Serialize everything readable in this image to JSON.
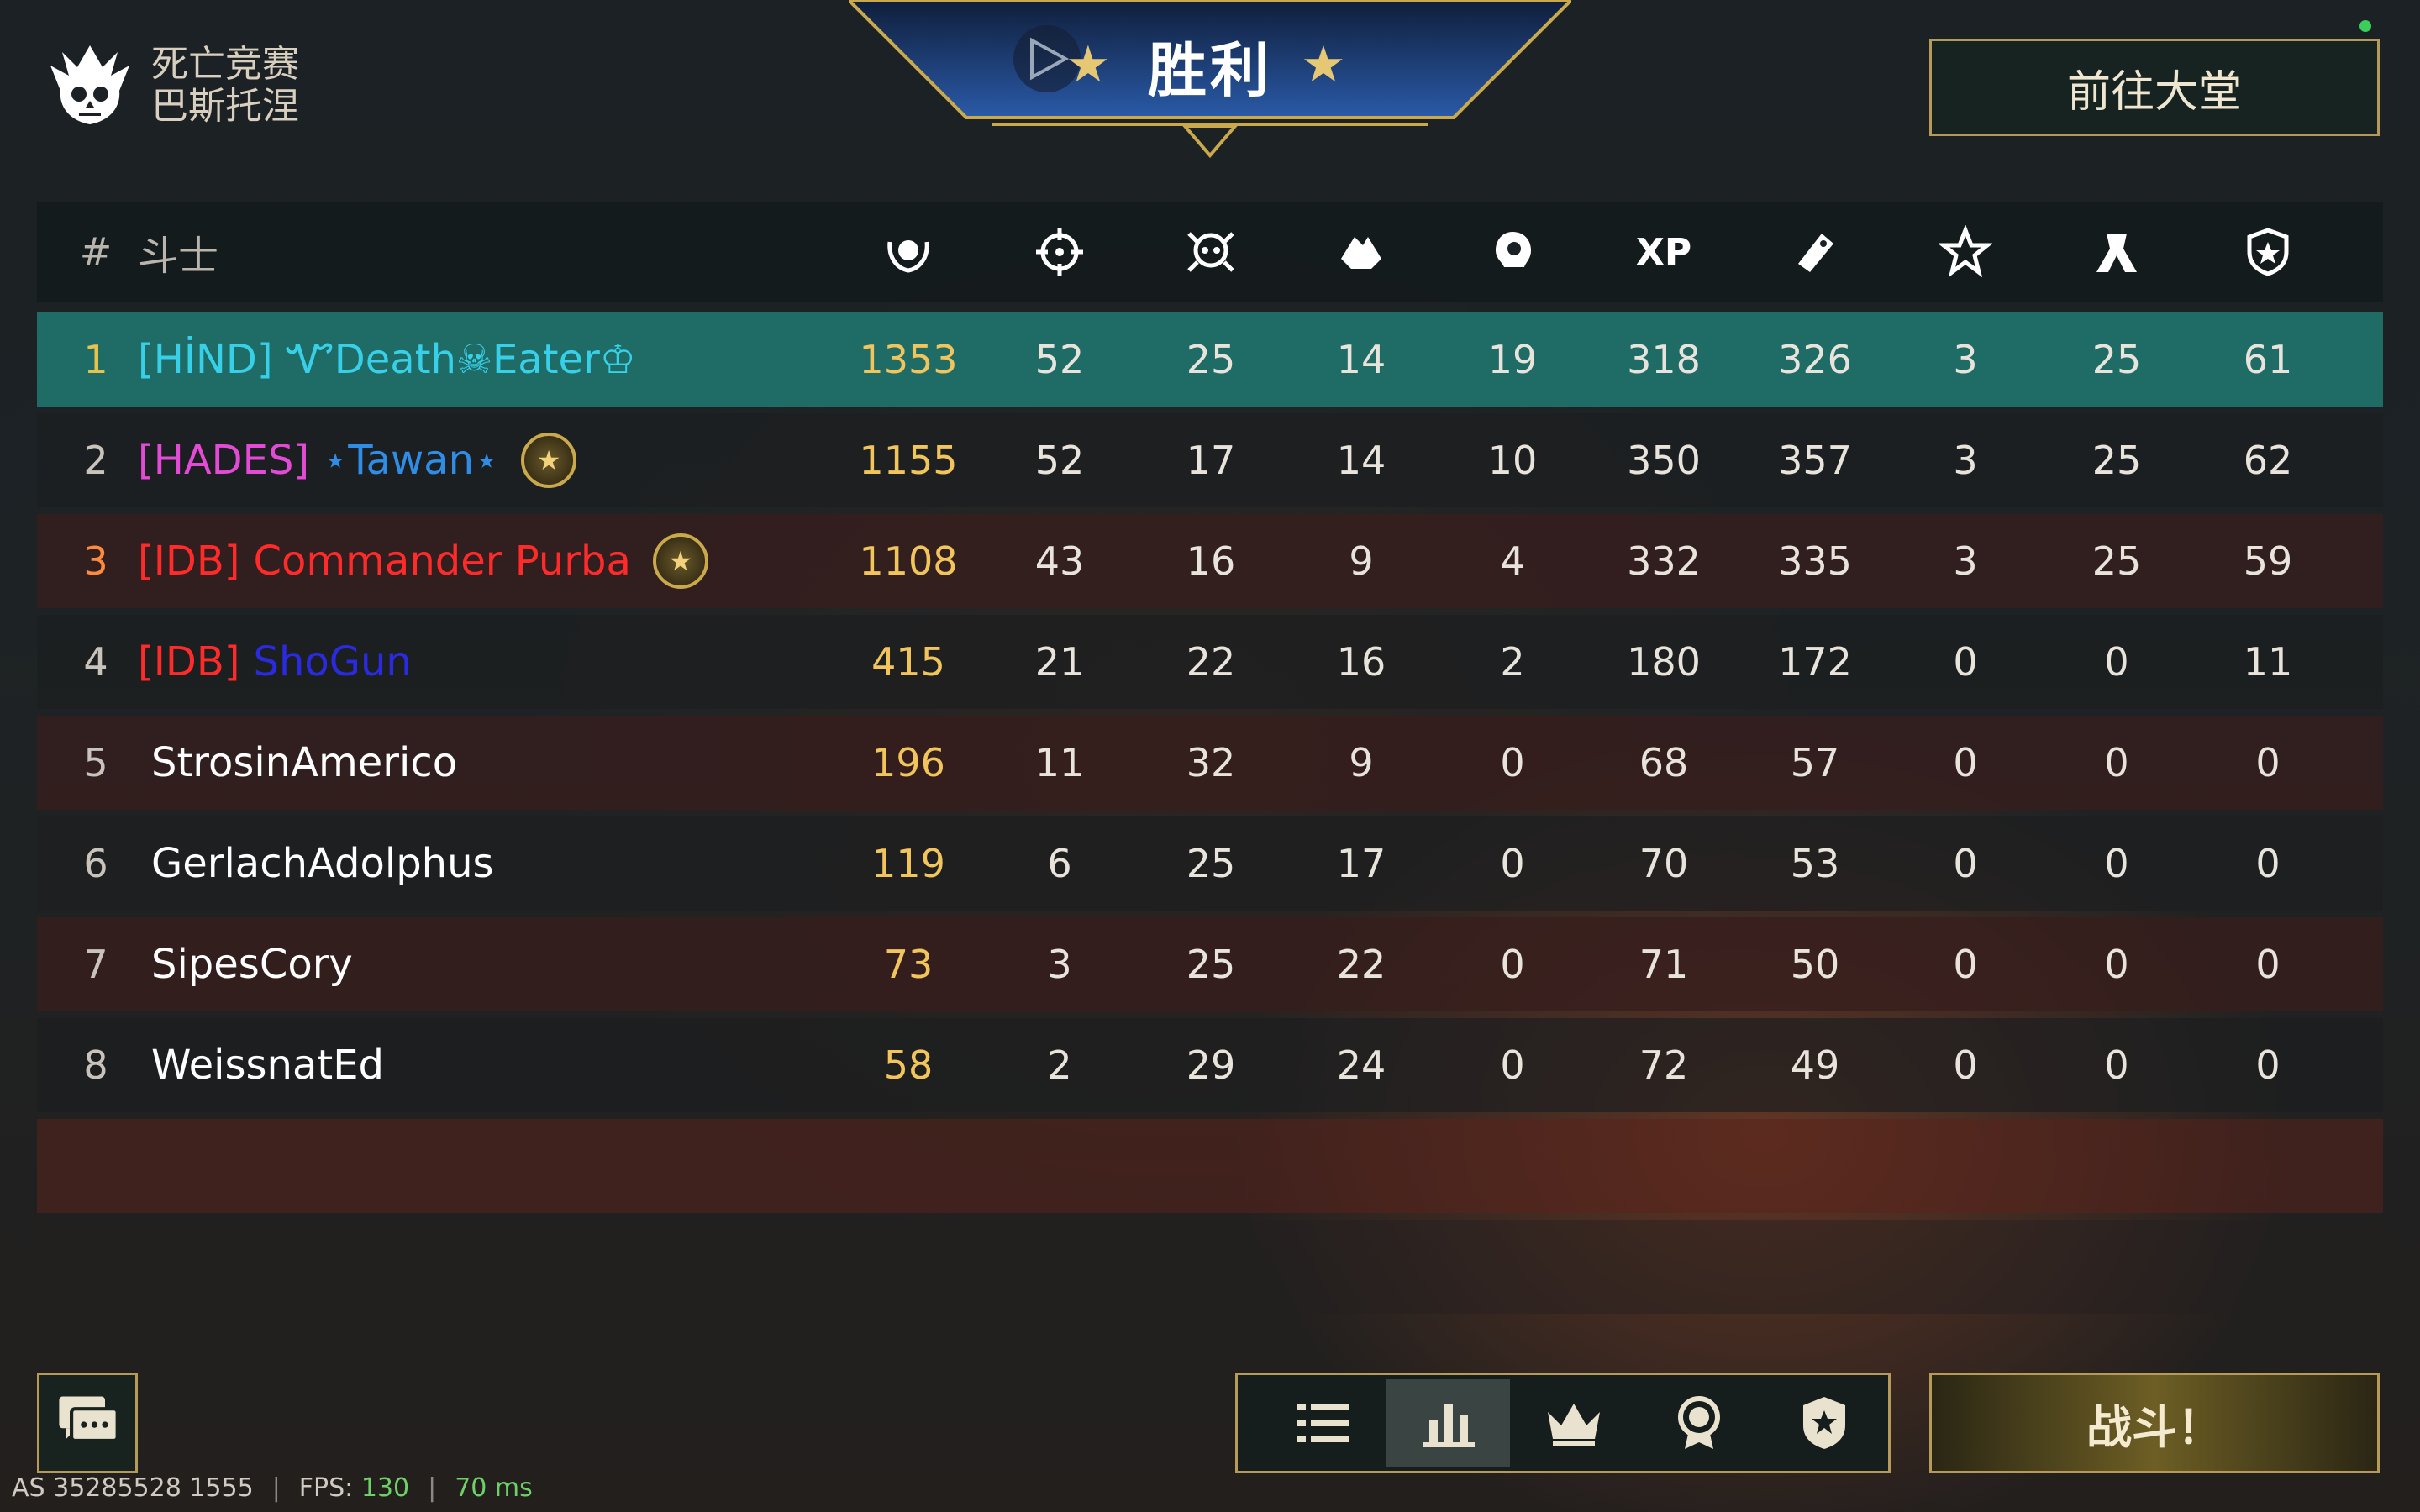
{
  "mode": {
    "line1": "死亡竞赛",
    "line2": "巴斯托涅"
  },
  "banner": {
    "title": "胜利",
    "star": "★"
  },
  "lobby_button": "前往大堂",
  "table": {
    "rank_header": "#",
    "name_header": "斗士",
    "column_icons": [
      "score-laurel-icon",
      "crosshair-kills-icon",
      "skull-deaths-icon",
      "hands-assists-icon",
      "headshot-icon",
      "xp-text",
      "token-icon",
      "star-icon",
      "rank-chevron-icon",
      "shield-icon"
    ],
    "xp_label": "XP",
    "rows": [
      {
        "rank": "1",
        "tag": "[HİND]",
        "name": "ᏉDeath☠Eater♔",
        "tag_color": "#38d0e8",
        "name_color": "#38d0e8",
        "badge": false,
        "values": [
          "1353",
          "52",
          "25",
          "14",
          "19",
          "318",
          "326",
          "3",
          "25",
          "61"
        ]
      },
      {
        "rank": "2",
        "tag": "[HADES]",
        "name": "⋆Tawan⋆",
        "tag_color": "#e34ad6",
        "name_color": "#2f8de6",
        "badge": true,
        "values": [
          "1155",
          "52",
          "17",
          "14",
          "10",
          "350",
          "357",
          "3",
          "25",
          "62"
        ]
      },
      {
        "rank": "3",
        "tag": "[IDB]",
        "name": "Commander Purba",
        "tag_color": "#ff2a2a",
        "name_color": "#ff2a2a",
        "badge": true,
        "values": [
          "1108",
          "43",
          "16",
          "9",
          "4",
          "332",
          "335",
          "3",
          "25",
          "59"
        ]
      },
      {
        "rank": "4",
        "tag": "[IDB]",
        "name": "ShoGun",
        "tag_color": "#ff2a2a",
        "name_color": "#2a2ae0",
        "badge": false,
        "values": [
          "415",
          "21",
          "22",
          "16",
          "2",
          "180",
          "172",
          "0",
          "0",
          "11"
        ]
      },
      {
        "rank": "5",
        "tag": "",
        "name": "StrosinAmerico",
        "tag_color": "#ffffff",
        "name_color": "#ffffff",
        "badge": false,
        "values": [
          "196",
          "11",
          "32",
          "9",
          "0",
          "68",
          "57",
          "0",
          "0",
          "0"
        ]
      },
      {
        "rank": "6",
        "tag": "",
        "name": "GerlachAdolphus",
        "tag_color": "#ffffff",
        "name_color": "#ffffff",
        "badge": false,
        "values": [
          "119",
          "6",
          "25",
          "17",
          "0",
          "70",
          "53",
          "0",
          "0",
          "0"
        ]
      },
      {
        "rank": "7",
        "tag": "",
        "name": "SipesCory",
        "tag_color": "#ffffff",
        "name_color": "#ffffff",
        "badge": false,
        "values": [
          "73",
          "3",
          "25",
          "22",
          "0",
          "71",
          "50",
          "0",
          "0",
          "0"
        ]
      },
      {
        "rank": "8",
        "tag": "",
        "name": "WeissnatEd",
        "tag_color": "#ffffff",
        "name_color": "#ffffff",
        "badge": false,
        "values": [
          "58",
          "2",
          "29",
          "24",
          "0",
          "72",
          "49",
          "0",
          "0",
          "0"
        ]
      }
    ]
  },
  "status_bar": {
    "server": "AS 35285528 1555",
    "fps_label": "FPS:",
    "fps_value": "130",
    "ping": "70 ms"
  },
  "tabs": [
    "list-icon",
    "bar-chart-icon",
    "crown-icon",
    "medal-icon",
    "shield-star-icon"
  ],
  "active_tab": "bar-chart-icon",
  "fight_button": "战斗！",
  "colors": {
    "accent_gold": "#b59a59",
    "highlight_row": "#1f6b66",
    "score_gold": "#f2c55c",
    "online_green": "#3bcf59"
  }
}
